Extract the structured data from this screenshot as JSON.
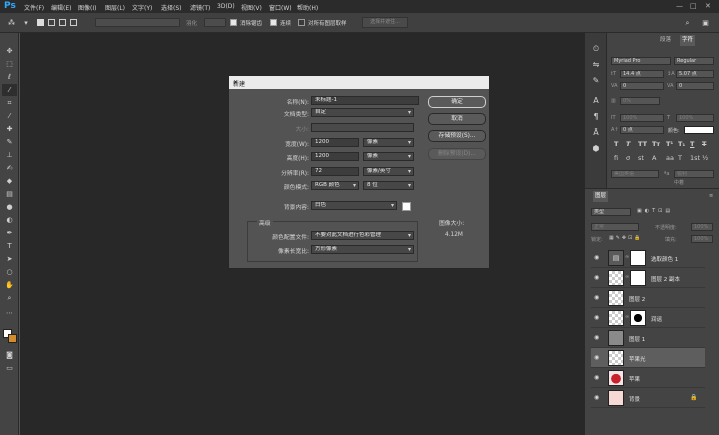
{
  "app": {
    "logo": "Ps"
  },
  "menu": [
    "文件(F)",
    "编辑(E)",
    "图像(I)",
    "图层(L)",
    "文字(Y)",
    "选择(S)",
    "滤镜(T)",
    "3D(D)",
    "视图(V)",
    "窗口(W)",
    "帮助(H)"
  ],
  "window_controls": {
    "minimize": "—",
    "restore": "□",
    "close": "✕"
  },
  "options_bar": {
    "feather_label": "羽化",
    "anti_alias": "消除锯齿",
    "anti_alias_checked": true,
    "contiguous": "连续",
    "contiguous_checked": true,
    "sample_all": "对所有图层取样",
    "sample_all_checked": false,
    "select_subject": "选择并遮住..."
  },
  "character_panel": {
    "tabs": [
      "段落",
      "字符"
    ],
    "font_family": "Myriad Pro",
    "font_style": "Regular",
    "font_size": "14.4 点",
    "leading": "5.07 点",
    "kerning": "0",
    "tracking": "0",
    "scale": "0%",
    "vertical_scale": "100%",
    "horizontal_scale": "100%",
    "baseline_shift": "0 点",
    "color_label": "颜色:",
    "language": "美国英语",
    "anti_alias_mode": "锐利",
    "language_option": "中着"
  },
  "layers_panel": {
    "tab": "图层",
    "search": "类型",
    "blend_mode": "正常",
    "opacity_label": "不透明度:",
    "opacity": "100%",
    "lock_label": "锁定:",
    "fill_label": "填充:",
    "fill": "100%",
    "layers": [
      {
        "name": "选取颜色 1",
        "thumb": "adjust",
        "mask": true,
        "selected": false,
        "locked": false
      },
      {
        "name": "图层 2 副本",
        "thumb": "checker",
        "mask": true,
        "selected": false,
        "locked": false
      },
      {
        "name": "图层 2",
        "thumb": "checker",
        "mask": false,
        "selected": false,
        "locked": false
      },
      {
        "name": "润谣",
        "thumb": "checker",
        "mask": true,
        "selected": false,
        "locked": false
      },
      {
        "name": "图层 1",
        "thumb": "gray",
        "mask": false,
        "selected": false,
        "locked": false
      },
      {
        "name": "苹果光",
        "thumb": "checker",
        "mask": false,
        "selected": true,
        "locked": false
      },
      {
        "name": "苹果",
        "thumb": "apple",
        "mask": false,
        "selected": false,
        "locked": false
      },
      {
        "name": "背景",
        "thumb": "pink",
        "mask": false,
        "selected": false,
        "locked": true
      }
    ]
  },
  "dialog": {
    "title": "新建",
    "name_label": "名称(N):",
    "name_value": "未标题-1",
    "doc_type_label": "文档类型:",
    "doc_type_value": "自定",
    "size_label": "大小:",
    "width_label": "宽度(W):",
    "width_value": "1200",
    "width_unit": "像素",
    "height_label": "高度(H):",
    "height_value": "1200",
    "height_unit": "像素",
    "resolution_label": "分辨率(R):",
    "resolution_value": "72",
    "resolution_unit": "像素/英寸",
    "color_mode_label": "颜色模式:",
    "color_mode_value": "RGB 颜色",
    "bit_depth": "8 位",
    "background_label": "背景内容:",
    "background_value": "白色",
    "advanced_label": "高级",
    "color_profile_label": "颜色配置文件:",
    "color_profile_value": "不要对此文档进行色彩管理",
    "pixel_aspect_label": "像素长宽比:",
    "pixel_aspect_value": "方形像素",
    "ok": "确定",
    "cancel": "取消",
    "save_preset": "存储预设(S)...",
    "delete_preset": "删除预设(D)...",
    "image_size_label": "图像大小:",
    "image_size_value": "4.12M"
  }
}
